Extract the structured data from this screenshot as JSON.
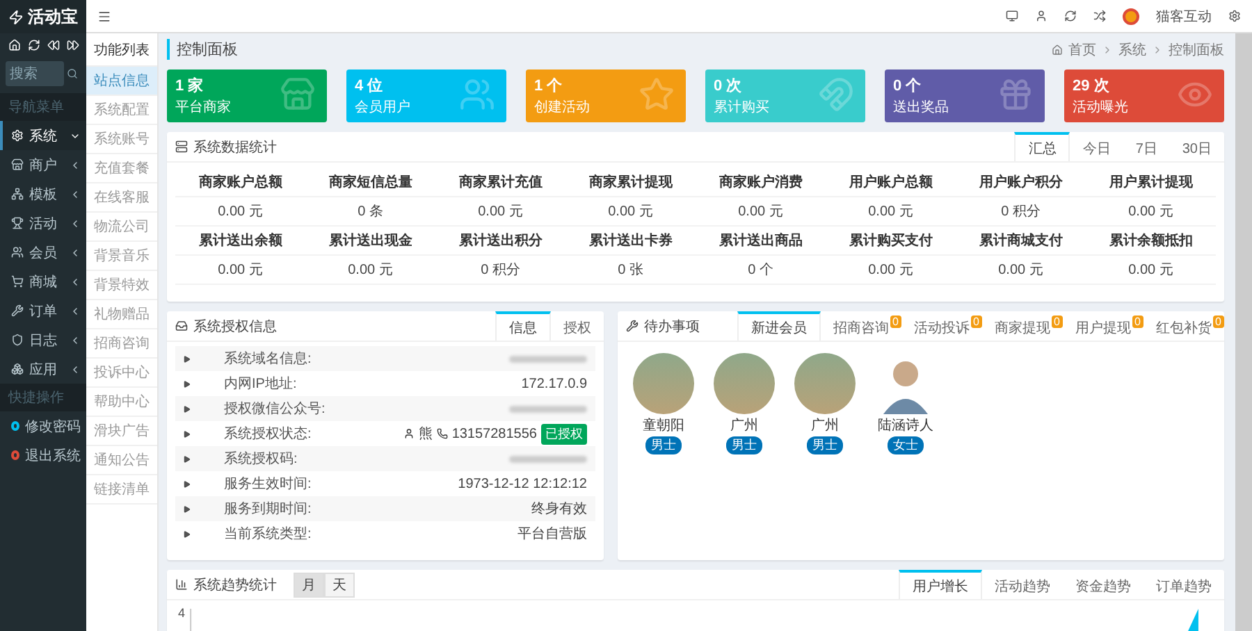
{
  "sidebar": {
    "logo": "活动宝",
    "search": {
      "placeholder": "搜索"
    },
    "nav_title": "导航菜单",
    "nav_items": [
      {
        "label": "系统",
        "expanded": true,
        "selected": true
      },
      {
        "label": "商户",
        "expanded": false,
        "selected": false
      },
      {
        "label": "模板",
        "expanded": false,
        "selected": false
      },
      {
        "label": "活动",
        "expanded": false,
        "selected": false
      },
      {
        "label": "会员",
        "expanded": false,
        "selected": false
      },
      {
        "label": "商城",
        "expanded": false,
        "selected": false
      },
      {
        "label": "订单",
        "expanded": false,
        "selected": false
      },
      {
        "label": "日志",
        "expanded": false,
        "selected": false
      },
      {
        "label": "应用",
        "expanded": false,
        "selected": false
      }
    ],
    "shortcut_title": "快捷操作",
    "shortcuts": [
      {
        "label": "修改密码",
        "color": "#00c0ef"
      },
      {
        "label": "退出系统",
        "color": "#dd4b39"
      }
    ]
  },
  "submenu": {
    "title": "功能列表",
    "items": [
      {
        "label": "站点信息",
        "selected": true
      },
      {
        "label": "系统配置",
        "selected": false
      },
      {
        "label": "系统账号",
        "selected": false
      },
      {
        "label": "充值套餐",
        "selected": false
      },
      {
        "label": "在线客服",
        "selected": false
      },
      {
        "label": "物流公司",
        "selected": false
      },
      {
        "label": "背景音乐",
        "selected": false
      },
      {
        "label": "背景特效",
        "selected": false
      },
      {
        "label": "礼物赠品",
        "selected": false
      },
      {
        "label": "招商咨询",
        "selected": false
      },
      {
        "label": "投诉中心",
        "selected": false
      },
      {
        "label": "帮助中心",
        "selected": false
      },
      {
        "label": "滑块广告",
        "selected": false
      },
      {
        "label": "通知公告",
        "selected": false
      },
      {
        "label": "链接清单",
        "selected": false
      }
    ]
  },
  "topbar": {
    "user": "猫客互动"
  },
  "page": {
    "title": "控制面板",
    "breadcrumb": [
      "首页",
      "系统",
      "控制面板"
    ]
  },
  "stat_cards": [
    {
      "value": "1 家",
      "label": "平台商家",
      "color": "#00a65a"
    },
    {
      "value": "4 位",
      "label": "会员用户",
      "color": "#00c0ef"
    },
    {
      "value": "1 个",
      "label": "创建活动",
      "color": "#f39c12"
    },
    {
      "value": "0 次",
      "label": "累计购买",
      "color": "#39cccc"
    },
    {
      "value": "0 个",
      "label": "送出奖品",
      "color": "#605ca8"
    },
    {
      "value": "29 次",
      "label": "活动曝光",
      "color": "#dd4b39"
    }
  ],
  "stats_panel": {
    "title": "系统数据统计",
    "tabs": [
      {
        "label": "汇总",
        "selected": true
      },
      {
        "label": "今日",
        "selected": false
      },
      {
        "label": "7日",
        "selected": false
      },
      {
        "label": "30日",
        "selected": false
      }
    ],
    "rows": [
      [
        {
          "heading": "商家账户总额",
          "value": "0.00 元"
        },
        {
          "heading": "商家短信总量",
          "value": "0 条"
        },
        {
          "heading": "商家累计充值",
          "value": "0.00 元"
        },
        {
          "heading": "商家累计提现",
          "value": "0.00 元"
        },
        {
          "heading": "商家账户消费",
          "value": "0.00 元"
        },
        {
          "heading": "用户账户总额",
          "value": "0.00 元"
        },
        {
          "heading": "用户账户积分",
          "value": "0 积分"
        },
        {
          "heading": "用户累计提现",
          "value": "0.00 元"
        }
      ],
      [
        {
          "heading": "累计送出余额",
          "value": "0.00 元"
        },
        {
          "heading": "累计送出现金",
          "value": "0.00 元"
        },
        {
          "heading": "累计送出积分",
          "value": "0 积分"
        },
        {
          "heading": "累计送出卡券",
          "value": "0 张"
        },
        {
          "heading": "累计送出商品",
          "value": "0 个"
        },
        {
          "heading": "累计购买支付",
          "value": "0.00 元"
        },
        {
          "heading": "累计商城支付",
          "value": "0.00 元"
        },
        {
          "heading": "累计余额抵扣",
          "value": "0.00 元"
        }
      ]
    ]
  },
  "auth_panel": {
    "title": "系统授权信息",
    "tabs": [
      {
        "label": "信息",
        "selected": true
      },
      {
        "label": "授权",
        "selected": false
      }
    ],
    "rows": [
      {
        "label": "系统域名信息:",
        "kind": "blurred"
      },
      {
        "label": "内网IP地址:",
        "kind": "text",
        "value": "172.17.0.9"
      },
      {
        "label": "授权微信公众号:",
        "kind": "blurred"
      },
      {
        "label": "系统授权状态:",
        "kind": "status",
        "contact": "熊",
        "phone": "13157281556",
        "badge": "已授权"
      },
      {
        "label": "系统授权码:",
        "kind": "blurred"
      },
      {
        "label": "服务生效时间:",
        "kind": "text",
        "value": "1973-12-12 12:12:12"
      },
      {
        "label": "服务到期时间:",
        "kind": "text",
        "value": "终身有效"
      },
      {
        "label": "当前系统类型:",
        "kind": "text",
        "value": "平台自营版"
      }
    ]
  },
  "todo_panel": {
    "title": "待办事项",
    "tabs": [
      {
        "label": "新进会员",
        "selected": true
      },
      {
        "label": "招商咨询",
        "badge": "0",
        "selected": false
      },
      {
        "label": "活动投诉",
        "badge": "0",
        "selected": false
      },
      {
        "label": "商家提现",
        "badge": "0",
        "selected": false
      },
      {
        "label": "用户提现",
        "badge": "0",
        "selected": false
      },
      {
        "label": "红包补货",
        "badge": "0",
        "selected": false
      }
    ],
    "members": [
      {
        "name": "童朝阳",
        "tag": "男士",
        "kind": "photo"
      },
      {
        "name": "广州",
        "tag": "男士",
        "kind": "photo"
      },
      {
        "name": "广州",
        "tag": "男士",
        "kind": "photo"
      },
      {
        "name": "陆涵诗人",
        "tag": "女士",
        "kind": "cartoon"
      }
    ]
  },
  "trend_panel": {
    "title": "系统趋势统计",
    "toggle": [
      {
        "label": "月",
        "selected": true
      },
      {
        "label": "天",
        "selected": false
      }
    ],
    "tabs": [
      {
        "label": "用户增长",
        "selected": true
      },
      {
        "label": "活动趋势",
        "selected": false
      },
      {
        "label": "资金趋势",
        "selected": false
      },
      {
        "label": "订单趋势",
        "selected": false
      }
    ],
    "axis_tick": "4"
  }
}
